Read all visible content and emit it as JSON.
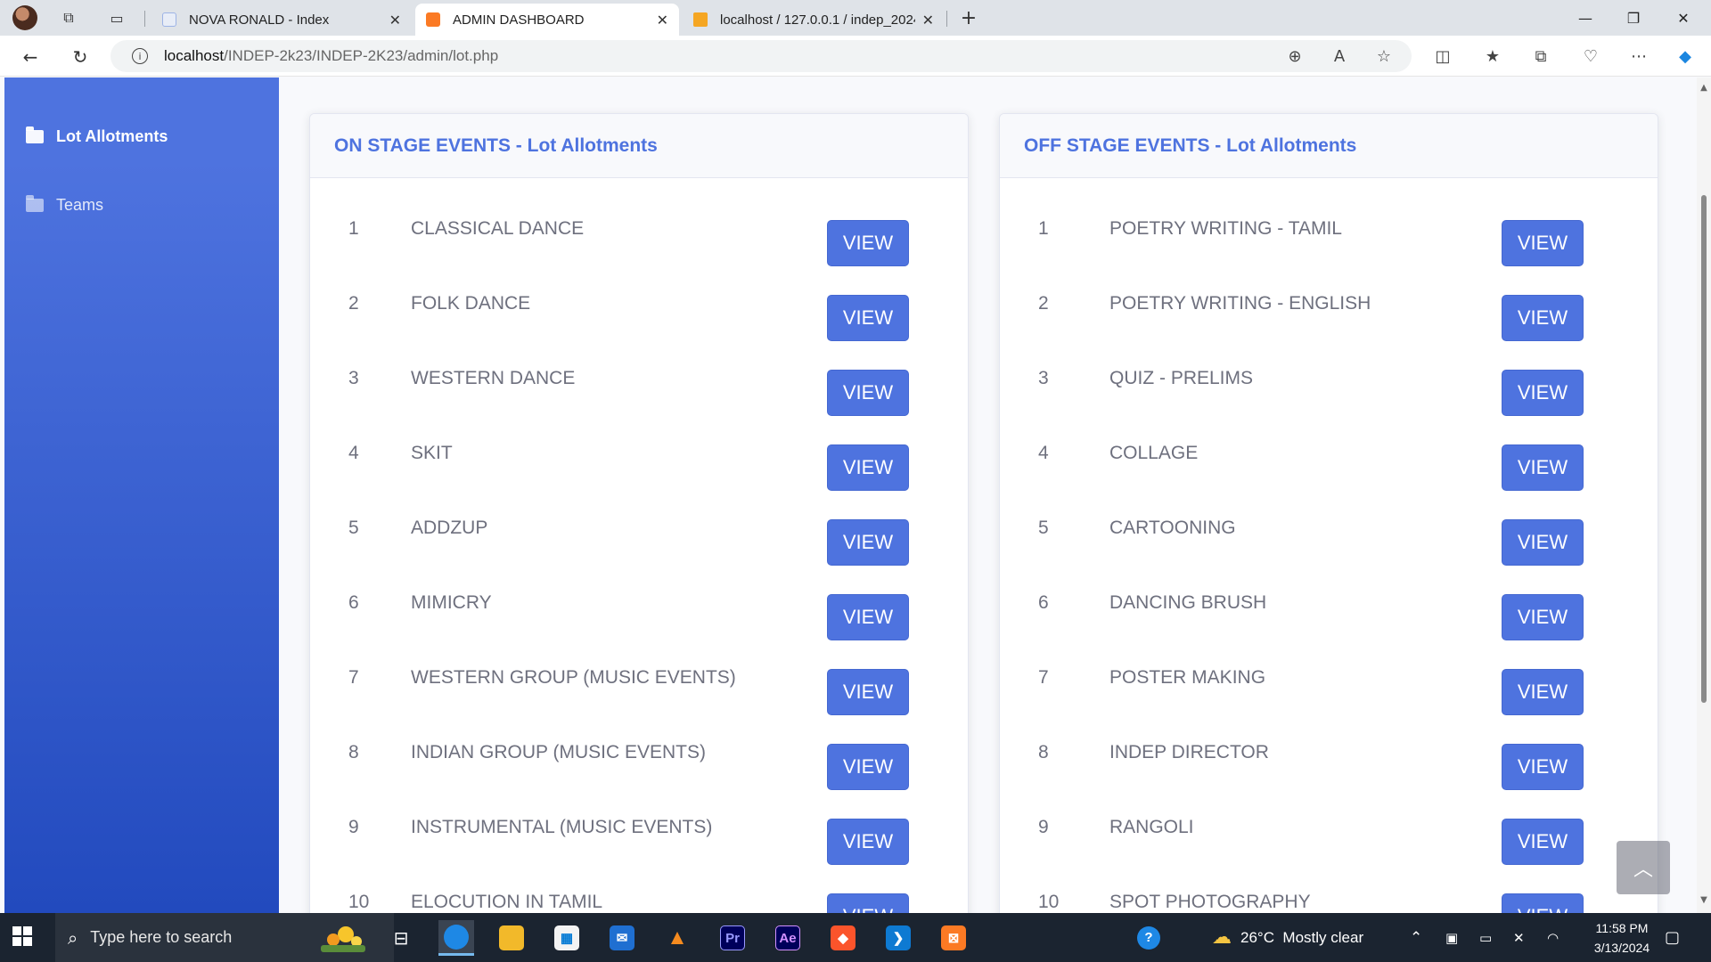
{
  "browser": {
    "tabs": [
      {
        "title": "NOVA RONALD - Index",
        "active": false
      },
      {
        "title": "ADMIN DASHBOARD",
        "active": true
      },
      {
        "title": "localhost / 127.0.0.1 / indep_2024",
        "active": false
      }
    ],
    "url_host": "localhost",
    "url_path": "/INDEP-2k23/INDEP-2K23/admin/lot.php"
  },
  "sidebar": {
    "items": [
      {
        "label": "Lot Allotments",
        "active": true
      },
      {
        "label": "Teams",
        "active": false
      }
    ]
  },
  "on_stage": {
    "title": "ON STAGE EVENTS - Lot Allotments",
    "button_label": "VIEW",
    "events": [
      {
        "num": "1",
        "name": "CLASSICAL DANCE"
      },
      {
        "num": "2",
        "name": "FOLK DANCE"
      },
      {
        "num": "3",
        "name": "WESTERN DANCE"
      },
      {
        "num": "4",
        "name": "SKIT"
      },
      {
        "num": "5",
        "name": "ADDZUP"
      },
      {
        "num": "6",
        "name": "MIMICRY"
      },
      {
        "num": "7",
        "name": "WESTERN GROUP (MUSIC EVENTS)"
      },
      {
        "num": "8",
        "name": "INDIAN GROUP (MUSIC EVENTS)"
      },
      {
        "num": "9",
        "name": "INSTRUMENTAL (MUSIC EVENTS)"
      },
      {
        "num": "10",
        "name": "ELOCUTION IN TAMIL"
      }
    ]
  },
  "off_stage": {
    "title": "OFF STAGE EVENTS - Lot Allotments",
    "button_label": "VIEW",
    "events": [
      {
        "num": "1",
        "name": "POETRY WRITING - TAMIL"
      },
      {
        "num": "2",
        "name": "POETRY WRITING - ENGLISH"
      },
      {
        "num": "3",
        "name": "QUIZ - PRELIMS"
      },
      {
        "num": "4",
        "name": "COLLAGE"
      },
      {
        "num": "5",
        "name": "CARTOONING"
      },
      {
        "num": "6",
        "name": "DANCING BRUSH"
      },
      {
        "num": "7",
        "name": "POSTER MAKING"
      },
      {
        "num": "8",
        "name": "INDEP DIRECTOR"
      },
      {
        "num": "9",
        "name": "RANGOLI"
      },
      {
        "num": "10",
        "name": "SPOT PHOTOGRAPHY"
      }
    ]
  },
  "taskbar": {
    "search_placeholder": "Type here to search",
    "weather": "26°C  Mostly clear",
    "time": "11:58 PM",
    "date": "3/13/2024"
  },
  "colors": {
    "primary": "#4e73df",
    "sidebar_end": "#224abe",
    "text_muted": "#6e707e"
  }
}
